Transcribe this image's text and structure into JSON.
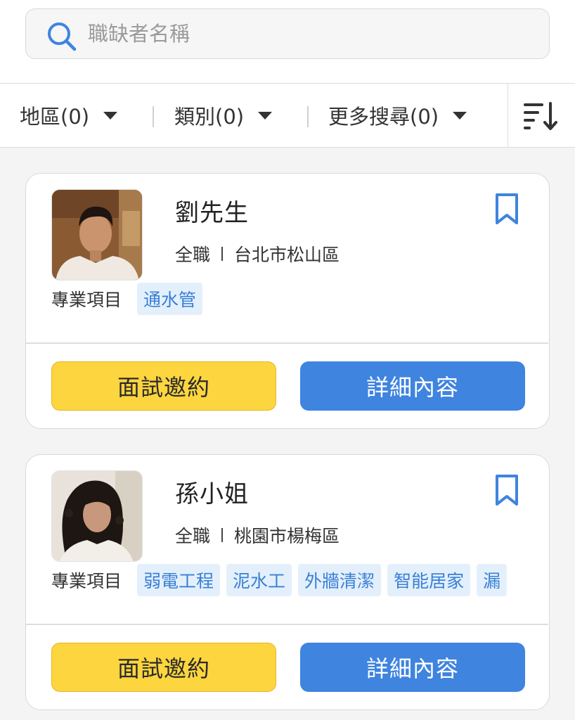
{
  "search": {
    "placeholder": "職缺者名稱",
    "value": ""
  },
  "filters": [
    {
      "label": "地區(0)"
    },
    {
      "label": "類別(0)"
    },
    {
      "label": "更多搜尋(0)"
    }
  ],
  "cards": [
    {
      "name": "劉先生",
      "job_type": "全職",
      "location": "台北市松山區",
      "skills_label": "專業項目",
      "skills": [
        "通水管"
      ],
      "invite_label": "面試邀約",
      "detail_label": "詳細內容"
    },
    {
      "name": "孫小姐",
      "job_type": "全職",
      "location": "桃園市楊梅區",
      "skills_label": "專業項目",
      "skills": [
        "弱電工程",
        "泥水工",
        "外牆清潔",
        "智能居家",
        "漏"
      ],
      "invite_label": "面試邀約",
      "detail_label": "詳細內容"
    }
  ],
  "colors": {
    "accent_blue": "#3f84df",
    "invite_yellow": "#fdd53e",
    "tag_bg": "#e3f0fc",
    "tag_text": "#3a7fd5"
  },
  "icons": {
    "search": "search-icon",
    "sort": "sort-descending-icon",
    "bookmark": "bookmark-icon",
    "filter_caret": "caret-down-icon"
  }
}
